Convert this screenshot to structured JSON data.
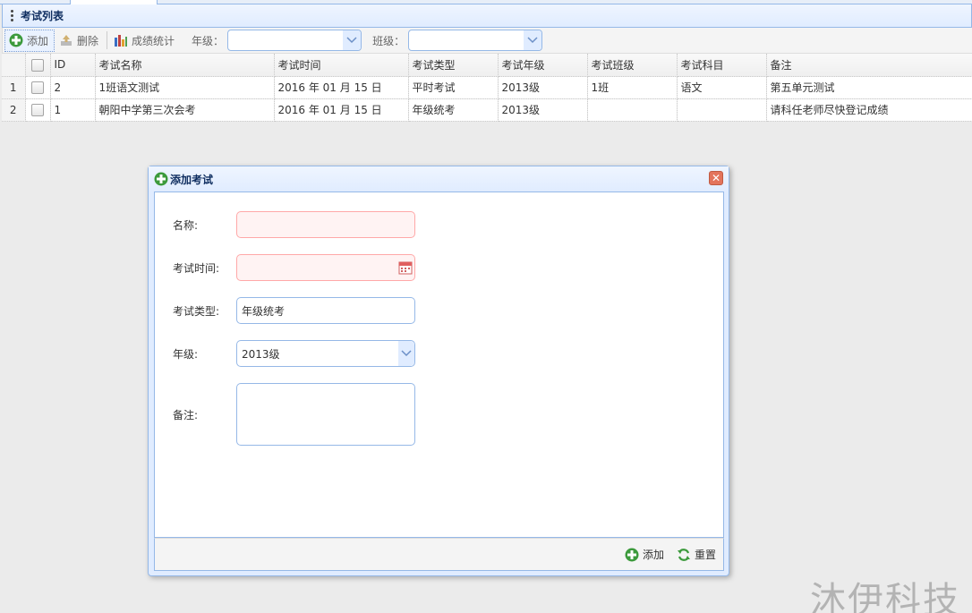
{
  "panel": {
    "title": "考试列表"
  },
  "toolbar": {
    "add_label": "添加",
    "delete_label": "删除",
    "stats_label": "成绩统计",
    "grade_label": "年级：",
    "class_label": "班级："
  },
  "grid": {
    "columns": [
      "ID",
      "考试名称",
      "考试时间",
      "考试类型",
      "考试年级",
      "考试班级",
      "考试科目",
      "备注"
    ],
    "rows": [
      {
        "rownum": "1",
        "id": "2",
        "name": "1班语文测试",
        "time": "2016 年 01 月 15 日",
        "type": "平时考试",
        "grade": "2013级",
        "class": "1班",
        "subject": "语文",
        "remark": "第五单元测试"
      },
      {
        "rownum": "2",
        "id": "1",
        "name": "朝阳中学第三次会考",
        "time": "2016 年 01 月 15 日",
        "type": "年级统考",
        "grade": "2013级",
        "class": "",
        "subject": "",
        "remark": "请科任老师尽快登记成绩"
      }
    ]
  },
  "dialog": {
    "title": "添加考试",
    "fields": {
      "name_label": "名称:",
      "time_label": "考试时间:",
      "type_label": "考试类型:",
      "type_value": "年级统考",
      "grade_label": "年级:",
      "grade_value": "2013级",
      "remark_label": "备注:"
    },
    "add_button": "添加",
    "reset_button": "重置"
  },
  "watermark": "沐伊科技",
  "colors": {
    "accent_border": "#95b8e7",
    "header_bg": "#e0ecff",
    "invalid_bg": "#fff3f3"
  }
}
